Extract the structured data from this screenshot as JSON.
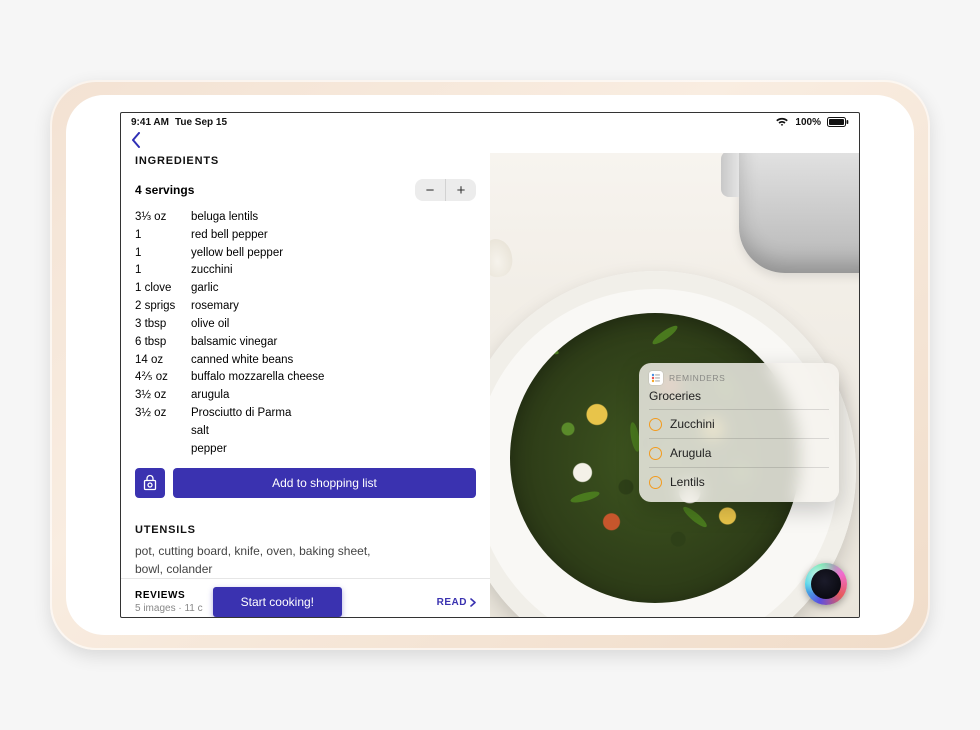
{
  "status": {
    "time": "9:41 AM",
    "date": "Tue Sep 15",
    "battery_pct": "100%"
  },
  "ingredients": {
    "title": "INGREDIENTS",
    "servings": "4 servings",
    "rows": [
      {
        "qty": "3⅓ oz",
        "name": "beluga lentils"
      },
      {
        "qty": "1",
        "name": "red bell pepper"
      },
      {
        "qty": "1",
        "name": "yellow bell pepper"
      },
      {
        "qty": "1",
        "name": "zucchini"
      },
      {
        "qty": "1 clove",
        "name": "garlic"
      },
      {
        "qty": "2 sprigs",
        "name": "rosemary"
      },
      {
        "qty": "3 tbsp",
        "name": "olive oil"
      },
      {
        "qty": "6 tbsp",
        "name": "balsamic vinegar"
      },
      {
        "qty": "14 oz",
        "name": "canned white beans"
      },
      {
        "qty": "4⅖ oz",
        "name": "buffalo mozzarella cheese"
      },
      {
        "qty": "3½ oz",
        "name": "arugula"
      },
      {
        "qty": "3½ oz",
        "name": "Prosciutto di Parma"
      },
      {
        "qty": "",
        "name": "salt"
      },
      {
        "qty": "",
        "name": "pepper"
      }
    ],
    "add_label": "Add to shopping list"
  },
  "utensils": {
    "title": "UTENSILS",
    "text": "pot, cutting board, knife, oven, baking sheet, bowl, colander"
  },
  "reviews": {
    "title": "REVIEWS",
    "meta": "5 images · 11 c",
    "read_label": "READ"
  },
  "start_label": "Start cooking!",
  "reminders": {
    "app_label": "REMINDERS",
    "list_title": "Groceries",
    "items": [
      "Zucchini",
      "Arugula",
      "Lentils"
    ]
  }
}
